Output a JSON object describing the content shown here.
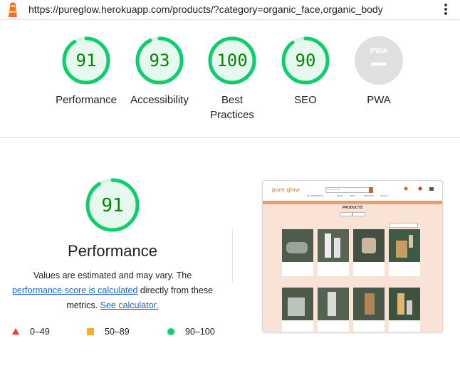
{
  "browser": {
    "url": "https://pureglow.herokuapp.com/products/?category=organic_face,organic_body",
    "logo_icon": "lighthouse-icon",
    "menu_icon": "kebab-menu-icon"
  },
  "categories": [
    {
      "id": "performance",
      "score": "91",
      "label": "Performance",
      "color": "#0cce6b",
      "text_color": "#008800",
      "fraction": 0.91
    },
    {
      "id": "accessibility",
      "score": "93",
      "label": "Accessibility",
      "color": "#0cce6b",
      "text_color": "#008800",
      "fraction": 0.93
    },
    {
      "id": "best-practices",
      "score": "100",
      "label_line1": "Best",
      "label_line2": "Practices",
      "color": "#0cce6b",
      "text_color": "#008800",
      "fraction": 1.0
    },
    {
      "id": "seo",
      "score": "90",
      "label": "SEO",
      "color": "#0cce6b",
      "text_color": "#008800",
      "fraction": 0.9
    },
    {
      "id": "pwa",
      "badge": "PWA",
      "label": "PWA",
      "color": "#e0e0e0"
    }
  ],
  "performance_detail": {
    "score": "91",
    "fraction": 0.91,
    "title": "Performance",
    "desc_line1": "Values are estimated and may vary. The",
    "desc_link1": "performance score is calculated",
    "desc_mid": " directly from these",
    "desc_line3a": "metrics. ",
    "desc_link2": "See calculator."
  },
  "legend": [
    {
      "range": "0–49",
      "shape": "triangle",
      "color": "#ff3333"
    },
    {
      "range": "50–89",
      "shape": "square",
      "color": "#ffaa33"
    },
    {
      "range": "90–100",
      "shape": "circle",
      "color": "#0cce6b"
    }
  ],
  "thumbnail": {
    "brand": "pure glow",
    "search_placeholder": "search our site",
    "menu_items": [
      "ALL PRODUCTS",
      "FACE",
      "BODY",
      "ORGANIC",
      "SALE %"
    ],
    "heading": "PRODUCTS",
    "colors": {
      "accent": "#c46a3a",
      "background": "#f9e3d6",
      "banner": "#e9a06a"
    }
  }
}
